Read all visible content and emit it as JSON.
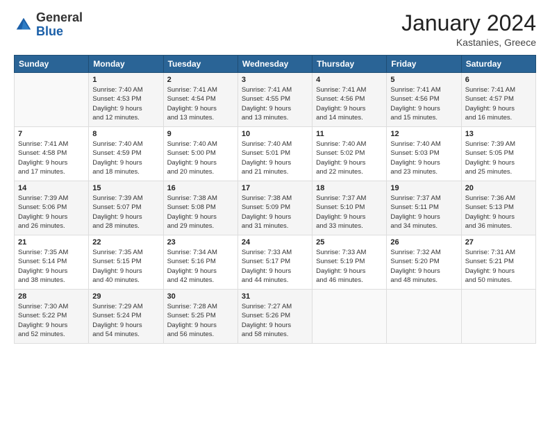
{
  "logo": {
    "general": "General",
    "blue": "Blue"
  },
  "header": {
    "month_year": "January 2024",
    "location": "Kastanies, Greece"
  },
  "days_of_week": [
    "Sunday",
    "Monday",
    "Tuesday",
    "Wednesday",
    "Thursday",
    "Friday",
    "Saturday"
  ],
  "weeks": [
    [
      {
        "day": "",
        "info": ""
      },
      {
        "day": "1",
        "info": "Sunrise: 7:40 AM\nSunset: 4:53 PM\nDaylight: 9 hours\nand 12 minutes."
      },
      {
        "day": "2",
        "info": "Sunrise: 7:41 AM\nSunset: 4:54 PM\nDaylight: 9 hours\nand 13 minutes."
      },
      {
        "day": "3",
        "info": "Sunrise: 7:41 AM\nSunset: 4:55 PM\nDaylight: 9 hours\nand 13 minutes."
      },
      {
        "day": "4",
        "info": "Sunrise: 7:41 AM\nSunset: 4:56 PM\nDaylight: 9 hours\nand 14 minutes."
      },
      {
        "day": "5",
        "info": "Sunrise: 7:41 AM\nSunset: 4:56 PM\nDaylight: 9 hours\nand 15 minutes."
      },
      {
        "day": "6",
        "info": "Sunrise: 7:41 AM\nSunset: 4:57 PM\nDaylight: 9 hours\nand 16 minutes."
      }
    ],
    [
      {
        "day": "7",
        "info": "Sunrise: 7:41 AM\nSunset: 4:58 PM\nDaylight: 9 hours\nand 17 minutes."
      },
      {
        "day": "8",
        "info": "Sunrise: 7:40 AM\nSunset: 4:59 PM\nDaylight: 9 hours\nand 18 minutes."
      },
      {
        "day": "9",
        "info": "Sunrise: 7:40 AM\nSunset: 5:00 PM\nDaylight: 9 hours\nand 20 minutes."
      },
      {
        "day": "10",
        "info": "Sunrise: 7:40 AM\nSunset: 5:01 PM\nDaylight: 9 hours\nand 21 minutes."
      },
      {
        "day": "11",
        "info": "Sunrise: 7:40 AM\nSunset: 5:02 PM\nDaylight: 9 hours\nand 22 minutes."
      },
      {
        "day": "12",
        "info": "Sunrise: 7:40 AM\nSunset: 5:03 PM\nDaylight: 9 hours\nand 23 minutes."
      },
      {
        "day": "13",
        "info": "Sunrise: 7:39 AM\nSunset: 5:05 PM\nDaylight: 9 hours\nand 25 minutes."
      }
    ],
    [
      {
        "day": "14",
        "info": "Sunrise: 7:39 AM\nSunset: 5:06 PM\nDaylight: 9 hours\nand 26 minutes."
      },
      {
        "day": "15",
        "info": "Sunrise: 7:39 AM\nSunset: 5:07 PM\nDaylight: 9 hours\nand 28 minutes."
      },
      {
        "day": "16",
        "info": "Sunrise: 7:38 AM\nSunset: 5:08 PM\nDaylight: 9 hours\nand 29 minutes."
      },
      {
        "day": "17",
        "info": "Sunrise: 7:38 AM\nSunset: 5:09 PM\nDaylight: 9 hours\nand 31 minutes."
      },
      {
        "day": "18",
        "info": "Sunrise: 7:37 AM\nSunset: 5:10 PM\nDaylight: 9 hours\nand 33 minutes."
      },
      {
        "day": "19",
        "info": "Sunrise: 7:37 AM\nSunset: 5:11 PM\nDaylight: 9 hours\nand 34 minutes."
      },
      {
        "day": "20",
        "info": "Sunrise: 7:36 AM\nSunset: 5:13 PM\nDaylight: 9 hours\nand 36 minutes."
      }
    ],
    [
      {
        "day": "21",
        "info": "Sunrise: 7:35 AM\nSunset: 5:14 PM\nDaylight: 9 hours\nand 38 minutes."
      },
      {
        "day": "22",
        "info": "Sunrise: 7:35 AM\nSunset: 5:15 PM\nDaylight: 9 hours\nand 40 minutes."
      },
      {
        "day": "23",
        "info": "Sunrise: 7:34 AM\nSunset: 5:16 PM\nDaylight: 9 hours\nand 42 minutes."
      },
      {
        "day": "24",
        "info": "Sunrise: 7:33 AM\nSunset: 5:17 PM\nDaylight: 9 hours\nand 44 minutes."
      },
      {
        "day": "25",
        "info": "Sunrise: 7:33 AM\nSunset: 5:19 PM\nDaylight: 9 hours\nand 46 minutes."
      },
      {
        "day": "26",
        "info": "Sunrise: 7:32 AM\nSunset: 5:20 PM\nDaylight: 9 hours\nand 48 minutes."
      },
      {
        "day": "27",
        "info": "Sunrise: 7:31 AM\nSunset: 5:21 PM\nDaylight: 9 hours\nand 50 minutes."
      }
    ],
    [
      {
        "day": "28",
        "info": "Sunrise: 7:30 AM\nSunset: 5:22 PM\nDaylight: 9 hours\nand 52 minutes."
      },
      {
        "day": "29",
        "info": "Sunrise: 7:29 AM\nSunset: 5:24 PM\nDaylight: 9 hours\nand 54 minutes."
      },
      {
        "day": "30",
        "info": "Sunrise: 7:28 AM\nSunset: 5:25 PM\nDaylight: 9 hours\nand 56 minutes."
      },
      {
        "day": "31",
        "info": "Sunrise: 7:27 AM\nSunset: 5:26 PM\nDaylight: 9 hours\nand 58 minutes."
      },
      {
        "day": "",
        "info": ""
      },
      {
        "day": "",
        "info": ""
      },
      {
        "day": "",
        "info": ""
      }
    ]
  ]
}
